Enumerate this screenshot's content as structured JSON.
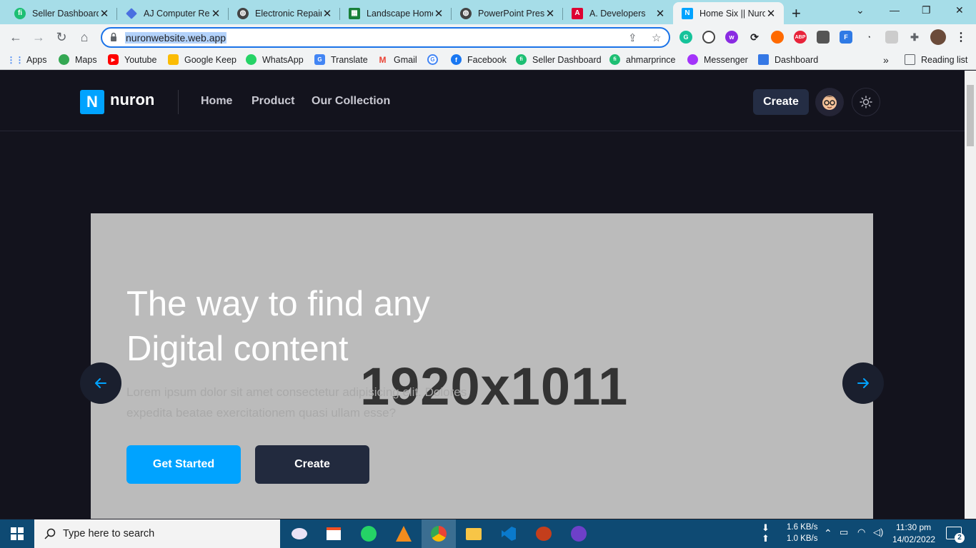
{
  "browser": {
    "tabs": [
      {
        "title": "Seller Dashboard",
        "icon": "fiverr-icon"
      },
      {
        "title": "AJ Computer Rep",
        "icon": "diamond-icon"
      },
      {
        "title": "Electronic Repair",
        "icon": "globe-icon"
      },
      {
        "title": "Landscape Home",
        "icon": "sheet-icon"
      },
      {
        "title": "PowerPoint Prese",
        "icon": "globe-icon"
      },
      {
        "title": "A. Developers",
        "icon": "angular-icon"
      },
      {
        "title": "Home Six || Nuro",
        "icon": "nuron-icon",
        "active": true
      }
    ],
    "url": "nuronwebsite.web.app",
    "bookmarks": [
      {
        "label": "Apps"
      },
      {
        "label": "Maps"
      },
      {
        "label": "Youtube"
      },
      {
        "label": "Google Keep"
      },
      {
        "label": "WhatsApp"
      },
      {
        "label": "Translate"
      },
      {
        "label": "Gmail"
      },
      {
        "label": ""
      },
      {
        "label": "Facebook"
      },
      {
        "label": "Seller Dashboard"
      },
      {
        "label": "ahmarprince"
      },
      {
        "label": "Messenger"
      },
      {
        "label": "Dashboard"
      }
    ],
    "reading_list": "Reading list",
    "overflow": "»"
  },
  "site": {
    "logo_letter": "N",
    "logo_text": "nuron",
    "nav": [
      "Home",
      "Product",
      "Our Collection"
    ],
    "header_create": "Create",
    "hero": {
      "title_line1": "The way to find any",
      "title_line2": "Digital content",
      "watermark": "1920x1011",
      "desc_line1": "Lorem ipsum dolor sit amet consectetur adipisicing elit. Dolores",
      "desc_line2": "expedita beatae exercitationem quasi ullam esse?",
      "btn_primary": "Get Started",
      "btn_secondary": "Create"
    }
  },
  "taskbar": {
    "search_placeholder": "Type here to search",
    "net_down": "1.6 KB/s",
    "net_up": "1.0 KB/s",
    "time": "11:30 pm",
    "date": "14/02/2022",
    "notifications": "2"
  },
  "colors": {
    "accent": "#00a3ff",
    "dark_button": "#222a3e",
    "site_bg": "#13131d",
    "hero_bg": "#bbbbbb"
  }
}
